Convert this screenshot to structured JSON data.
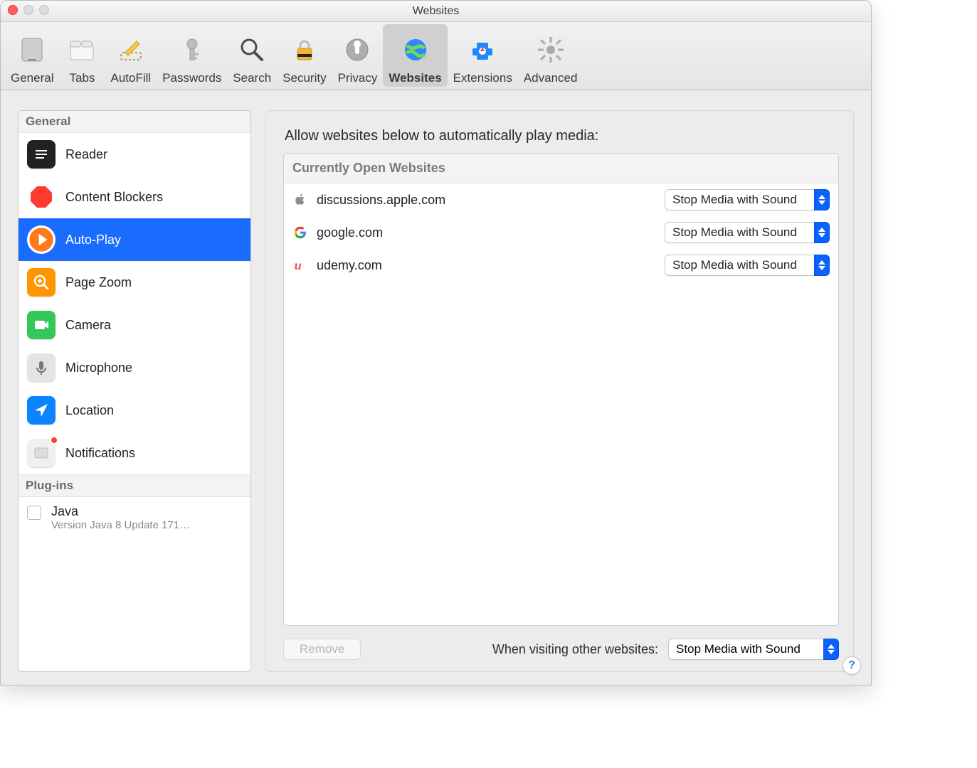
{
  "window": {
    "title": "Websites"
  },
  "toolbar": {
    "items": [
      {
        "id": "general",
        "label": "General"
      },
      {
        "id": "tabs",
        "label": "Tabs"
      },
      {
        "id": "autofill",
        "label": "AutoFill"
      },
      {
        "id": "passwords",
        "label": "Passwords"
      },
      {
        "id": "search",
        "label": "Search"
      },
      {
        "id": "security",
        "label": "Security"
      },
      {
        "id": "privacy",
        "label": "Privacy"
      },
      {
        "id": "websites",
        "label": "Websites",
        "selected": true
      },
      {
        "id": "extensions",
        "label": "Extensions"
      },
      {
        "id": "advanced",
        "label": "Advanced"
      }
    ]
  },
  "sidebar": {
    "sections": {
      "general_label": "General",
      "plugins_label": "Plug-ins"
    },
    "items": [
      {
        "id": "reader",
        "label": "Reader"
      },
      {
        "id": "content-blockers",
        "label": "Content Blockers"
      },
      {
        "id": "auto-play",
        "label": "Auto-Play",
        "selected": true
      },
      {
        "id": "page-zoom",
        "label": "Page Zoom"
      },
      {
        "id": "camera",
        "label": "Camera"
      },
      {
        "id": "microphone",
        "label": "Microphone"
      },
      {
        "id": "location",
        "label": "Location"
      },
      {
        "id": "notifications",
        "label": "Notifications",
        "badge": true
      }
    ],
    "plugins": [
      {
        "id": "java",
        "name": "Java",
        "version": "Version Java 8 Update 171…",
        "checked": false
      }
    ]
  },
  "panel": {
    "title": "Allow websites below to automatically play media:",
    "currently_open_label": "Currently Open Websites",
    "sites": [
      {
        "id": "apple",
        "icon": "apple",
        "domain": "discussions.apple.com",
        "policy": "Stop Media with Sound"
      },
      {
        "id": "google",
        "icon": "google",
        "domain": "google.com",
        "policy": "Stop Media with Sound"
      },
      {
        "id": "udemy",
        "icon": "udemy",
        "domain": "udemy.com",
        "policy": "Stop Media with Sound"
      }
    ],
    "remove_label": "Remove",
    "other_label": "When visiting other websites:",
    "other_policy": "Stop Media with Sound"
  },
  "help_label": "?"
}
